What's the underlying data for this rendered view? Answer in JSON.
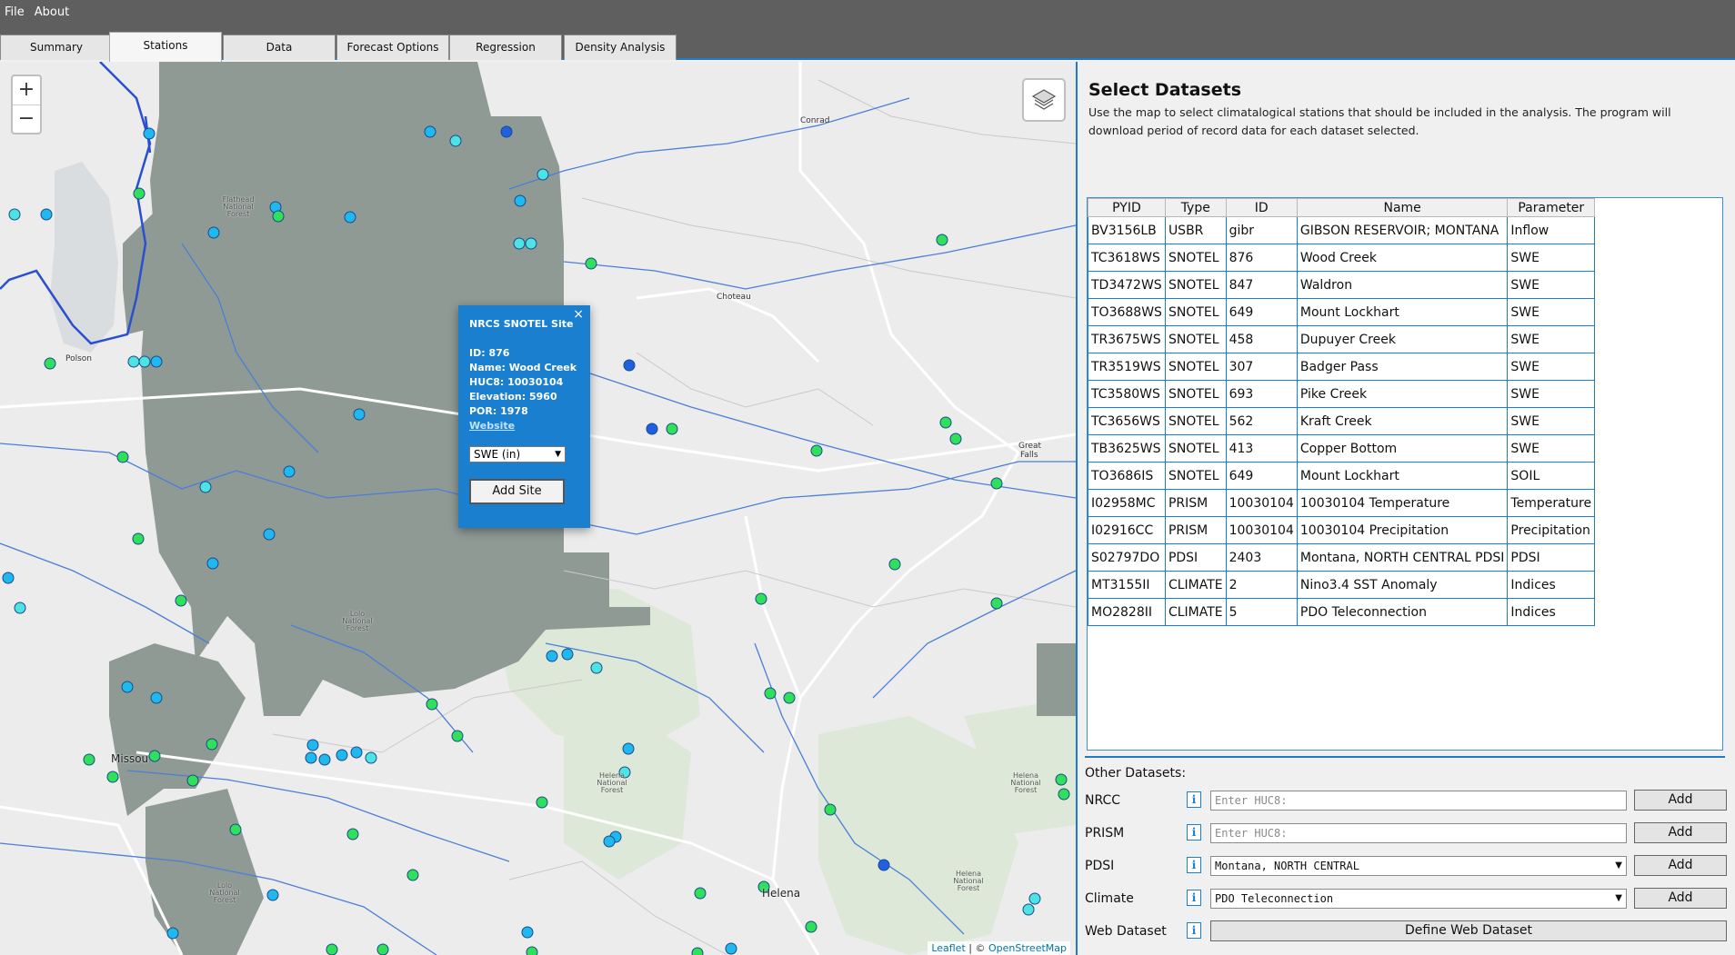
{
  "menu": [
    "File",
    "About"
  ],
  "tabs": [
    "Summary",
    "Stations",
    "Data",
    "Forecast Options",
    "Regression",
    "Density Analysis"
  ],
  "active_tab": "Stations",
  "map": {
    "zoom_in": "+",
    "zoom_out": "−",
    "attribution": {
      "leaflet": "Leaflet",
      "sep": " | © ",
      "osm": "OpenStreetMap"
    },
    "places": {
      "conrad": "Conrad",
      "choteau": "Choteau",
      "polson": "Polson",
      "great_falls_1": "Great",
      "great_falls_2": "Falls",
      "missoula": "Missou",
      "helena": "Helena",
      "flathead_nf": "Flathead National Forest",
      "lolo_nf_1": "Lolo National Forest",
      "lolo_nf_2": "Lolo National Forest",
      "helena_nf_1": "Helena National Forest",
      "helena_nf_2": "Helena National Forest",
      "helena_nf_3": "Helena National Forest"
    },
    "colors": {
      "land": "#ececec",
      "forest": "#8f9a95",
      "green_area": "#dde8d8",
      "river": "#4a7fd8",
      "road": "#ffffff",
      "boundary": "#2a4fd0"
    }
  },
  "popup": {
    "title": "NRCS SNOTEL Site",
    "close": "×",
    "id": "ID: 876",
    "name": "Name: Wood Creek",
    "huc8": "HUC8: 10030104",
    "elevation": "Elevation: 5960",
    "por": "POR: 1978",
    "website": "Website",
    "param_selected": "SWE (in)",
    "add_button": "Add Site"
  },
  "panel": {
    "title": "Select Datasets",
    "description": "Use the map to select climatalogical stations that should be included in the analysis. The program will download period of record data for each dataset selected.",
    "columns": [
      "PYID",
      "Type",
      "ID",
      "Name",
      "Parameter"
    ],
    "rows": [
      [
        "BV3156LB",
        "USBR",
        "gibr",
        "GIBSON RESERVOIR; MONTANA",
        "Inflow"
      ],
      [
        "TC3618WS",
        "SNOTEL",
        "876",
        "Wood Creek",
        "SWE"
      ],
      [
        "TD3472WS",
        "SNOTEL",
        "847",
        "Waldron",
        "SWE"
      ],
      [
        "TO3688WS",
        "SNOTEL",
        "649",
        "Mount Lockhart",
        "SWE"
      ],
      [
        "TR3675WS",
        "SNOTEL",
        "458",
        "Dupuyer Creek",
        "SWE"
      ],
      [
        "TR3519WS",
        "SNOTEL",
        "307",
        "Badger Pass",
        "SWE"
      ],
      [
        "TC3580WS",
        "SNOTEL",
        "693",
        "Pike Creek",
        "SWE"
      ],
      [
        "TC3656WS",
        "SNOTEL",
        "562",
        "Kraft Creek",
        "SWE"
      ],
      [
        "TB3625WS",
        "SNOTEL",
        "413",
        "Copper Bottom",
        "SWE"
      ],
      [
        "TO3686IS",
        "SNOTEL",
        "649",
        "Mount Lockhart",
        "SOIL"
      ],
      [
        "I02958MC",
        "PRISM",
        "10030104",
        "10030104 Temperature",
        "Temperature"
      ],
      [
        "I02916CC",
        "PRISM",
        "10030104",
        "10030104 Precipitation",
        "Precipitation"
      ],
      [
        "S02797DO",
        "PDSI",
        "2403",
        "Montana, NORTH CENTRAL PDSI",
        "PDSI"
      ],
      [
        "MT3155II",
        "CLIMATE",
        "2",
        "Nino3.4 SST Anomaly",
        "Indices"
      ],
      [
        "MO2828II",
        "CLIMATE",
        "5",
        "PDO Teleconnection",
        "Indices"
      ]
    ],
    "other_label": "Other Datasets:",
    "other": {
      "nrcc": {
        "label": "NRCC",
        "placeholder": "Enter HUC8:",
        "add": "Add"
      },
      "prism": {
        "label": "PRISM",
        "placeholder": "Enter HUC8:",
        "add": "Add"
      },
      "pdsi": {
        "label": "PDSI",
        "value": "Montana, NORTH CENTRAL",
        "add": "Add"
      },
      "climate": {
        "label": "Climate",
        "value": "PDO Teleconnection",
        "add": "Add"
      },
      "web": {
        "label": "Web Dataset",
        "button": "Define Web Dataset"
      }
    },
    "info_icon": "i"
  }
}
